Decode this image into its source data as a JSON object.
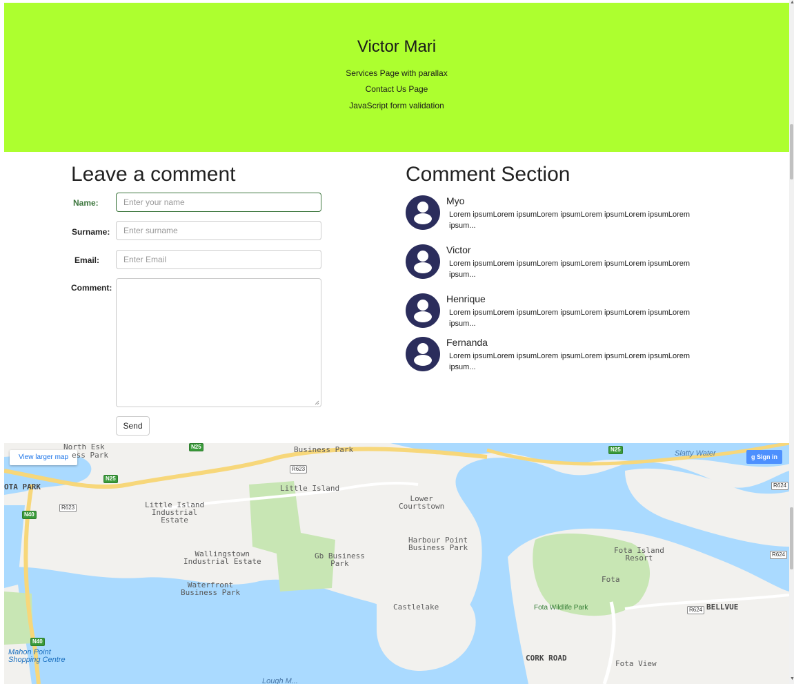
{
  "header": {
    "site_title": "Victor Mari",
    "nav": [
      {
        "label": "Services Page with parallax"
      },
      {
        "label": "Contact Us Page"
      },
      {
        "label": "JavaScript form validation"
      }
    ],
    "background": "#adff2f"
  },
  "form": {
    "title": "Leave a comment",
    "name_label": "Name:",
    "name_placeholder": "Enter your name",
    "surname_label": "Surname:",
    "surname_placeholder": "Enter surname",
    "email_label": "Email:",
    "email_placeholder": "Enter Email",
    "comment_label": "Comment:",
    "send_label": "Send"
  },
  "comments": {
    "title": "Comment Section",
    "items": [
      {
        "author": "Myo",
        "text": "Lorem ipsumLorem ipsumLorem ipsumLorem ipsumLorem ipsumLorem ipsum..."
      },
      {
        "author": "Victor",
        "text": "Lorem ipsumLorem ipsumLorem ipsumLorem ipsumLorem ipsumLorem ipsum..."
      },
      {
        "author": "Henrique",
        "text": "Lorem ipsumLorem ipsumLorem ipsumLorem ipsumLorem ipsumLorem ipsum..."
      },
      {
        "author": "Fernanda",
        "text": "Lorem ipsumLorem ipsumLorem ipsumLorem ipsumLorem ipsumLorem ipsum..."
      }
    ],
    "avatar_color": "#2b2d5c"
  },
  "map": {
    "larger_map_label": "View larger map",
    "sign_in_label": "Sign in",
    "labels": {
      "north_esk": "North Esk",
      "business_park_partial": "ess Park",
      "business_park_top": "Business Park",
      "ota_park": "OTA PARK",
      "little_island": "Little Island",
      "little_island_industrial": "Little Island\nIndustrial\nEstate",
      "lower_courtstown": "Lower\nCourtstown",
      "harbour_point": "Harbour Point\nBusiness Park",
      "wallingstown": "Wallingstown\nIndustrial Estate",
      "gb_business": "Gb Business\nPark",
      "waterfront": "Waterfront\nBusiness Park",
      "castlelake": "Castlelake",
      "fota_island_resort": "Fota Island\nResort",
      "fota": "Fota",
      "fota_wildlife": "Fota Wildlife Park",
      "bellvue": "BELLVUE",
      "cork_road": "CORK ROAD",
      "fota_view": "Fota View",
      "slatty_water": "Slatty Water",
      "mahon_point": "Mahon Point\nShopping Centre",
      "lough": "Lough M..."
    },
    "roads": {
      "n25_a": "N25",
      "n25_b": "N25",
      "n25_c": "N25",
      "n40_a": "N40",
      "n40_b": "N40",
      "r623_a": "R623",
      "r623_b": "R623",
      "r624_a": "R624",
      "r624_b": "R624",
      "r624_c": "R624"
    },
    "water_color": "#aadaff",
    "land_color": "#f2f1ee",
    "park_color": "#c8e6b4"
  }
}
